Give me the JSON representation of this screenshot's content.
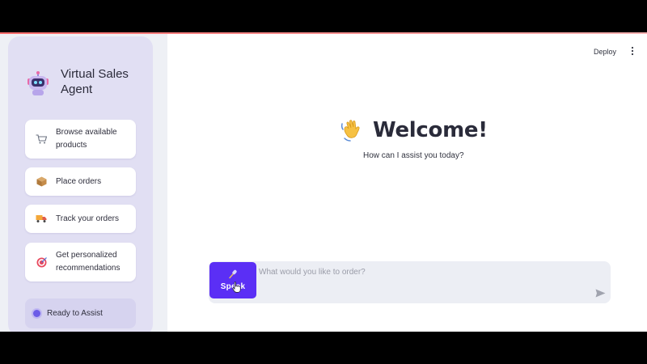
{
  "app": {
    "title": "Virtual Sales Agent",
    "deploy_label": "Deploy",
    "accent_color": "#5b2ff5"
  },
  "sidebar": {
    "features": [
      {
        "label": "Browse available products",
        "icon": "shopping-cart-icon"
      },
      {
        "label": "Place orders",
        "icon": "package-icon"
      },
      {
        "label": "Track your orders",
        "icon": "delivery-truck-icon"
      },
      {
        "label": "Get personalized recommendations",
        "icon": "target-icon"
      }
    ],
    "status": {
      "label": "Ready to Assist",
      "color": "#6c5ce7"
    }
  },
  "main": {
    "welcome_title": "Welcome!",
    "welcome_icon": "waving-hand-icon",
    "subtitle": "How can I assist you today?"
  },
  "chat": {
    "speak_label": "Speak",
    "placeholder": "What would you like to order?",
    "value": ""
  }
}
